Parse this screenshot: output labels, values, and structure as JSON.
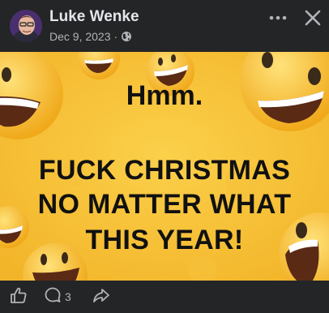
{
  "post": {
    "author": "Luke Wenke",
    "date": "Dec 9, 2023",
    "separator": "·",
    "visibility_icon": "globe-icon",
    "more_icon": "more-options-icon",
    "close_icon": "close-icon"
  },
  "image": {
    "line_1": "Hmm.",
    "line_2": "FUCK CHRISTMAS",
    "line_3": "NO MATTER WHAT",
    "line_4": "THIS YEAR!",
    "background_color": "#f4bf33",
    "decoration": "laughing emoji faces"
  },
  "actions": {
    "like_icon": "thumbs-up-icon",
    "comment_icon": "comment-icon",
    "comment_count": "3",
    "share_icon": "share-icon"
  }
}
